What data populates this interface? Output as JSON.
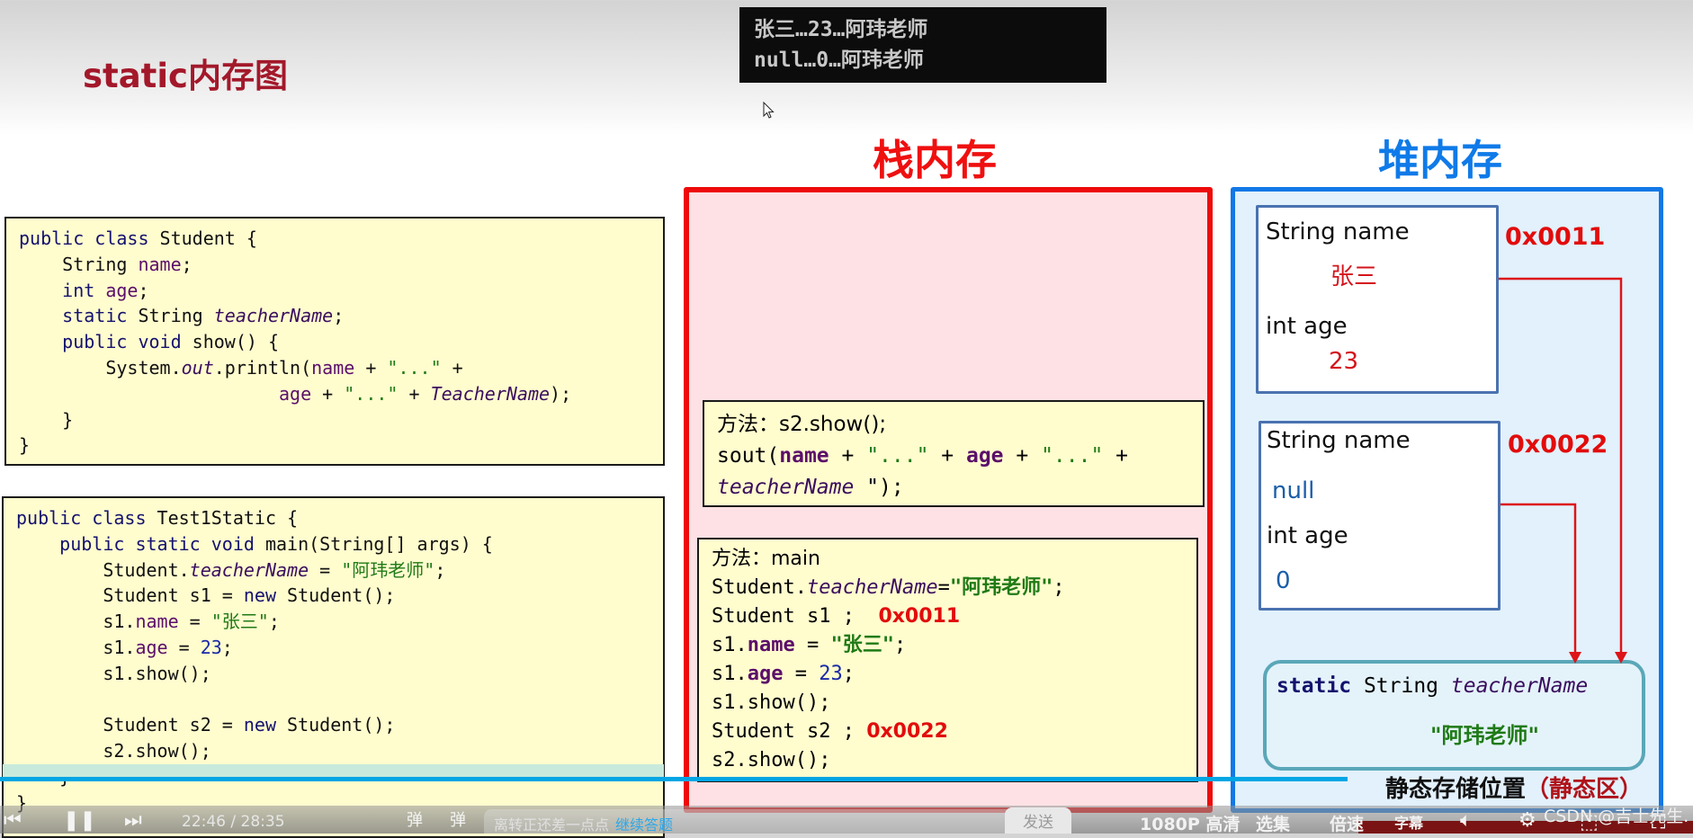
{
  "slide": {
    "title": "static内存图"
  },
  "console": {
    "lines": [
      "张三…23…阿玮老师",
      "null…0…阿玮老师"
    ]
  },
  "headings": {
    "stack": "栈内存",
    "heap": "堆内存"
  },
  "student_code": {
    "lines": [
      [
        {
          "t": "public class ",
          "c": "kw"
        },
        {
          "t": "Student {",
          "c": ""
        }
      ],
      [
        {
          "t": "    String ",
          "c": ""
        },
        {
          "t": "name",
          "c": "fld"
        },
        {
          "t": ";",
          "c": ""
        }
      ],
      [
        {
          "t": "    int ",
          "c": "kw"
        },
        {
          "t": "age",
          "c": "fld"
        },
        {
          "t": ";",
          "c": ""
        }
      ],
      [
        {
          "t": "    static ",
          "c": "kw"
        },
        {
          "t": "String ",
          "c": ""
        },
        {
          "t": "teacherName",
          "c": "it"
        },
        {
          "t": ";",
          "c": ""
        }
      ],
      [
        {
          "t": "    public void ",
          "c": "kw"
        },
        {
          "t": "show() {",
          "c": ""
        }
      ],
      [
        {
          "t": "        System.",
          "c": ""
        },
        {
          "t": "out",
          "c": "it"
        },
        {
          "t": ".println(",
          "c": ""
        },
        {
          "t": "name",
          "c": "fld"
        },
        {
          "t": " + ",
          "c": ""
        },
        {
          "t": "\"...\"",
          "c": "str"
        },
        {
          "t": " +",
          "c": ""
        }
      ],
      [
        {
          "t": "                        ",
          "c": ""
        },
        {
          "t": "age",
          "c": "fld"
        },
        {
          "t": " + ",
          "c": ""
        },
        {
          "t": "\"...\"",
          "c": "str"
        },
        {
          "t": " + ",
          "c": ""
        },
        {
          "t": "TeacherName",
          "c": "it"
        },
        {
          "t": ");",
          "c": ""
        }
      ],
      [
        {
          "t": "    }",
          "c": ""
        }
      ],
      [
        {
          "t": "}",
          "c": ""
        }
      ]
    ]
  },
  "test_code": {
    "lines": [
      [
        {
          "t": "public class ",
          "c": "kw"
        },
        {
          "t": "Test1Static {",
          "c": ""
        }
      ],
      [
        {
          "t": "    public static void ",
          "c": "kw"
        },
        {
          "t": "main(String[] args) {",
          "c": ""
        }
      ],
      [
        {
          "t": "        Student.",
          "c": ""
        },
        {
          "t": "teacherName",
          "c": "it"
        },
        {
          "t": " = ",
          "c": ""
        },
        {
          "t": "\"阿玮老师\"",
          "c": "str"
        },
        {
          "t": ";",
          "c": ""
        }
      ],
      [
        {
          "t": "        Student s1 = ",
          "c": ""
        },
        {
          "t": "new ",
          "c": "kw"
        },
        {
          "t": "Student();",
          "c": ""
        }
      ],
      [
        {
          "t": "        s1.",
          "c": ""
        },
        {
          "t": "name",
          "c": "fld"
        },
        {
          "t": " = ",
          "c": ""
        },
        {
          "t": "\"张三\"",
          "c": "str"
        },
        {
          "t": ";",
          "c": ""
        }
      ],
      [
        {
          "t": "        s1.",
          "c": ""
        },
        {
          "t": "age",
          "c": "fld"
        },
        {
          "t": " = ",
          "c": ""
        },
        {
          "t": "23",
          "c": "num"
        },
        {
          "t": ";",
          "c": ""
        }
      ],
      [
        {
          "t": "        s1.show();",
          "c": ""
        }
      ],
      [
        {
          "t": "",
          "c": ""
        }
      ],
      [
        {
          "t": "        Student s2 = ",
          "c": ""
        },
        {
          "t": "new ",
          "c": "kw"
        },
        {
          "t": "Student();",
          "c": ""
        }
      ],
      [
        {
          "t": "        s2.show();",
          "c": ""
        }
      ],
      [
        {
          "t": "    }",
          "c": ""
        }
      ],
      [
        {
          "t": "}",
          "c": ""
        }
      ]
    ]
  },
  "stack": {
    "show_frame": {
      "header": "方法：s2.show();",
      "lines": [
        [
          {
            "t": "sout(",
            "c": ""
          },
          {
            "t": "name",
            "c": "fld b"
          },
          {
            "t": " + ",
            "c": ""
          },
          {
            "t": "\"...\"",
            "c": "str"
          },
          {
            "t": " + ",
            "c": ""
          },
          {
            "t": "age",
            "c": "fld b"
          },
          {
            "t": " + ",
            "c": ""
          },
          {
            "t": "\"...\"",
            "c": "str"
          },
          {
            "t": " +",
            "c": ""
          }
        ],
        [
          {
            "t": "teacherName",
            "c": "it"
          },
          {
            "t": " \");",
            "c": ""
          }
        ]
      ]
    },
    "main_frame": {
      "header": "方法：main",
      "lines": [
        [
          {
            "t": "Student.",
            "c": ""
          },
          {
            "t": "teacherName",
            "c": "it"
          },
          {
            "t": "=",
            "c": ""
          },
          {
            "t": "\"阿玮老师\"",
            "c": "str b"
          },
          {
            "t": ";",
            "c": ""
          }
        ],
        [
          {
            "t": "Student s1 ;  ",
            "c": ""
          },
          {
            "t": "0x0011",
            "c": "addr"
          }
        ],
        [
          {
            "t": "s1.",
            "c": ""
          },
          {
            "t": "name",
            "c": "fld b"
          },
          {
            "t": " = ",
            "c": ""
          },
          {
            "t": "\"张三\"",
            "c": "str b"
          },
          {
            "t": ";",
            "c": ""
          }
        ],
        [
          {
            "t": "s1.",
            "c": ""
          },
          {
            "t": "age",
            "c": "fld b"
          },
          {
            "t": " = ",
            "c": ""
          },
          {
            "t": "23",
            "c": "num"
          },
          {
            "t": ";",
            "c": ""
          }
        ],
        [
          {
            "t": "s1.show();",
            "c": ""
          }
        ],
        [
          {
            "t": "Student s2 ; ",
            "c": ""
          },
          {
            "t": "0x0022",
            "c": "addr"
          }
        ],
        [
          {
            "t": "s2.show();",
            "c": ""
          }
        ]
      ]
    }
  },
  "heap": {
    "objects": [
      {
        "address": "0x0011",
        "name_label": "String name",
        "name_value": "张三",
        "age_label": "int age",
        "age_value": "23"
      },
      {
        "address": "0x0022",
        "name_label": "String name",
        "name_value": "null",
        "age_label": "int age",
        "age_value": "0"
      }
    ],
    "static_area": {
      "decl_keyword": "static",
      "decl_type": " String ",
      "decl_name": "teacherName",
      "value": "\"阿玮老师\"",
      "caption": "静态存储位置",
      "caption_paren": "（静态区）"
    }
  },
  "player": {
    "current_time": "22:46",
    "total_time": "28:35",
    "time_display": "22:46 / 28:35",
    "progress_fraction": 0.796,
    "danmaku_placeholder": "离转正还差一点点",
    "danmaku_link": "继续答题",
    "send_label": "发送",
    "quality": "1080P 高清",
    "episodes": "选集",
    "speed": "倍速",
    "subtitle": "字幕",
    "watermark": "CSDN @吉士先生.",
    "accent_color": "#00a6e4"
  }
}
